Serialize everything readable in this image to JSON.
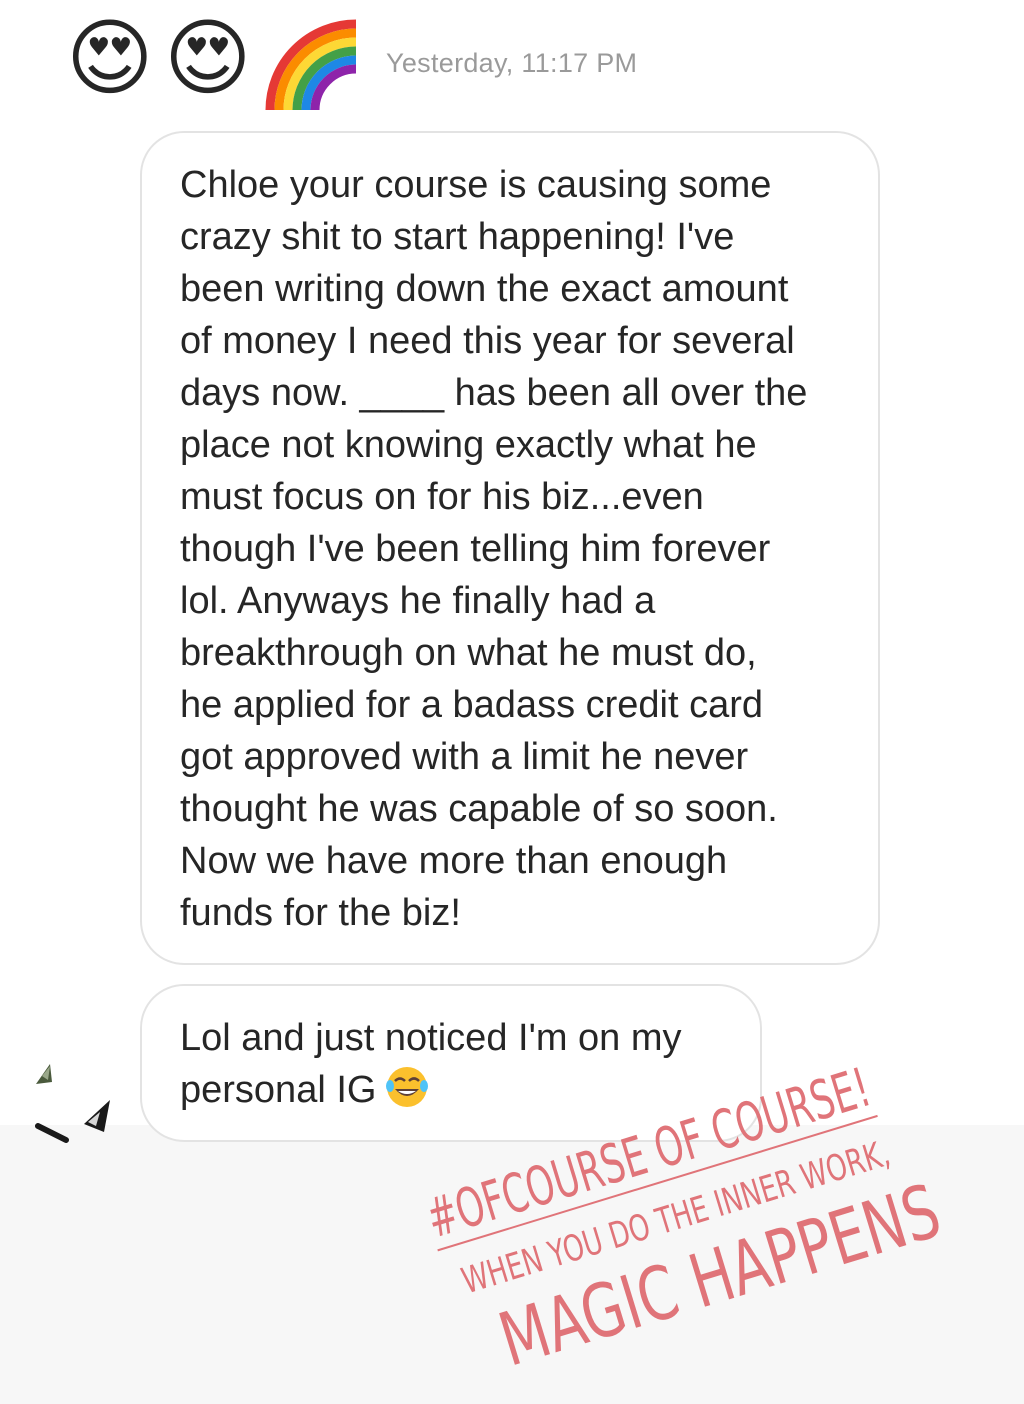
{
  "header": {
    "timestamp": "Yesterday, 11:17 PM",
    "emojis": [
      "heart-eyes-emoji",
      "heart-eyes-emoji",
      "rainbow-emoji"
    ]
  },
  "messages": [
    {
      "text": "Chloe your course is causing some\ncrazy shit to start happening! I've\nbeen writing down the exact amount\nof money I need this year for several\ndays now. ____ has been all over the\nplace not knowing exactly what he\nmust focus on for his biz...even\nthough I've been telling him forever\nlol. Anyways he finally had a\nbreakthrough on what he must do,\nhe applied for a badass credit card\ngot approved with a limit he never\nthought he was capable of so soon.\nNow we have more than enough\nfunds for the biz!"
    },
    {
      "text": "Lol and just noticed I'm on my\npersonal IG",
      "emoji": "tears-of-joy-emoji"
    }
  ],
  "overlay": {
    "line1": "#OFCOURSE OF COURSE!",
    "line2": "WHEN YOU DO THE INNER WORK,",
    "line3": "MAGIC HAPPENS",
    "color": "#e07479"
  }
}
